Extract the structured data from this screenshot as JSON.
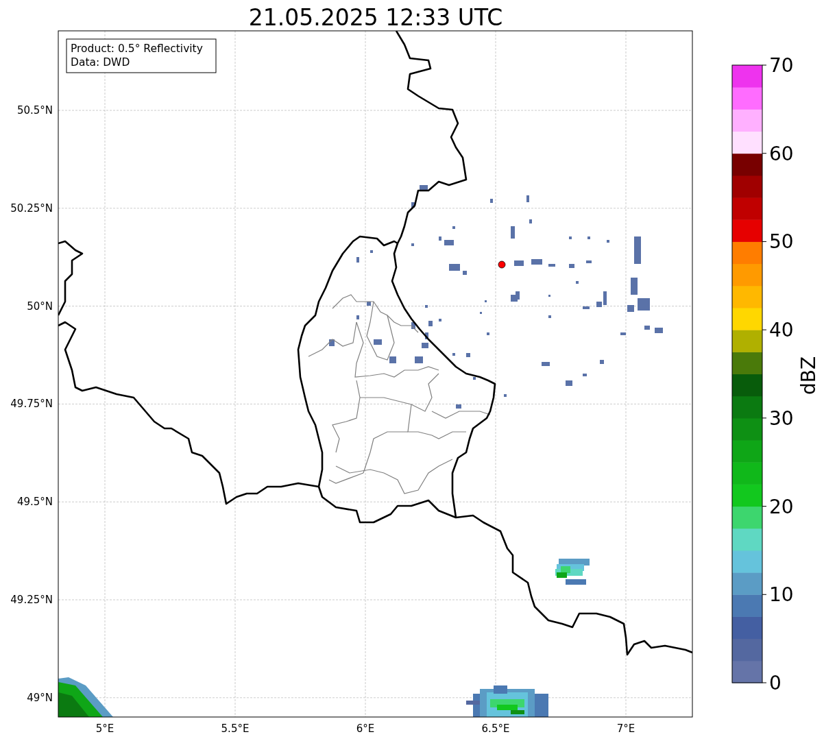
{
  "title": "21.05.2025 12:33 UTC",
  "annotation": [
    "Product: 0.5° Reflectivity",
    "Data: DWD"
  ],
  "x_ticks": [
    "5°E",
    "5.5°E",
    "6°E",
    "6.5°E",
    "7°E"
  ],
  "y_ticks": [
    "50.5°N",
    "50.25°N",
    "50°N",
    "49.75°N",
    "49.5°N",
    "49.25°N",
    "49°N"
  ],
  "colorbar": {
    "label": "dBZ",
    "ticks": [
      "70",
      "60",
      "50",
      "40",
      "30",
      "20",
      "10",
      "0"
    ],
    "segments": [
      {
        "color": "#6574a8"
      },
      {
        "color": "#5468a0"
      },
      {
        "color": "#445fa2"
      },
      {
        "color": "#4b79b2"
      },
      {
        "color": "#5b9cc5"
      },
      {
        "color": "#65c3dc"
      },
      {
        "color": "#5fd8c2"
      },
      {
        "color": "#3dd66e"
      },
      {
        "color": "#12c81e"
      },
      {
        "color": "#10b81a"
      },
      {
        "color": "#0fa617"
      },
      {
        "color": "#0e9014"
      },
      {
        "color": "#0b7a11"
      },
      {
        "color": "#085c0b"
      },
      {
        "color": "#4a7a0a"
      },
      {
        "color": "#b0b000"
      },
      {
        "color": "#ffd700"
      },
      {
        "color": "#ffb800"
      },
      {
        "color": "#ff9a00"
      },
      {
        "color": "#ff7d00"
      },
      {
        "color": "#e60000"
      },
      {
        "color": "#c00000"
      },
      {
        "color": "#a00000"
      },
      {
        "color": "#780000"
      },
      {
        "color": "#ffe0ff"
      },
      {
        "color": "#ffb0ff"
      },
      {
        "color": "#ff6cff"
      },
      {
        "color": "#ee33ee"
      }
    ]
  }
}
